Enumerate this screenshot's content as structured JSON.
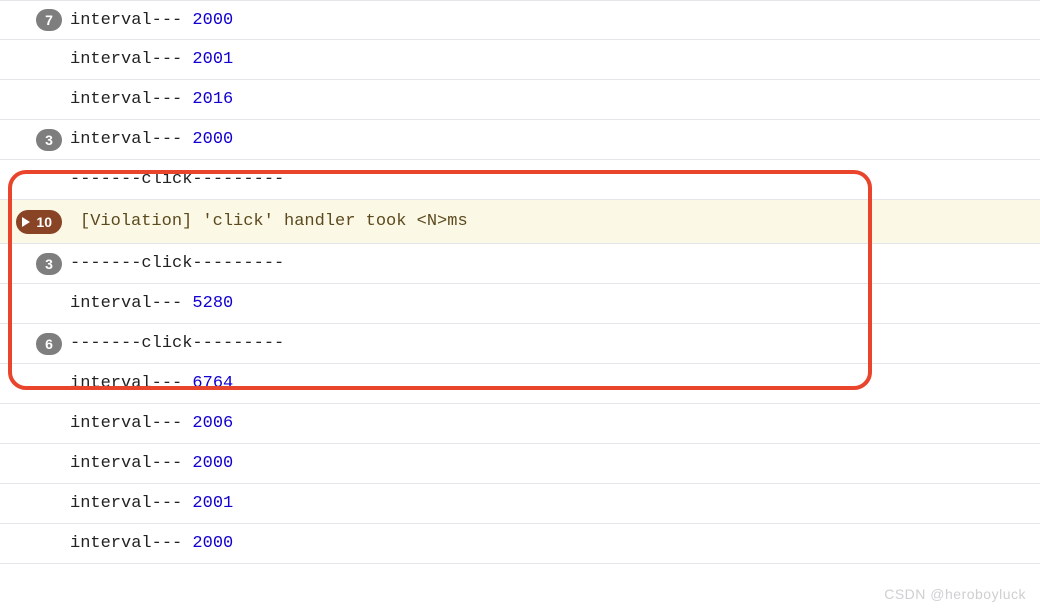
{
  "labels": {
    "interval_prefix": "interval--- ",
    "click_line": "-------click---------",
    "violation_text": "[Violation] 'click' handler took <N>ms"
  },
  "rows": [
    {
      "badge": "7",
      "type": "interval",
      "value": "2000"
    },
    {
      "badge": null,
      "type": "interval",
      "value": "2001"
    },
    {
      "badge": null,
      "type": "interval",
      "value": "2016"
    },
    {
      "badge": "3",
      "type": "interval",
      "value": "2000"
    },
    {
      "badge": null,
      "type": "click"
    },
    {
      "badge": "10",
      "type": "violation"
    },
    {
      "badge": "3",
      "type": "click"
    },
    {
      "badge": null,
      "type": "interval",
      "value": "5280"
    },
    {
      "badge": "6",
      "type": "click"
    },
    {
      "badge": null,
      "type": "interval",
      "value": "6764"
    },
    {
      "badge": null,
      "type": "interval",
      "value": "2006"
    },
    {
      "badge": null,
      "type": "interval",
      "value": "2000"
    },
    {
      "badge": null,
      "type": "interval",
      "value": "2001"
    },
    {
      "badge": null,
      "type": "interval",
      "value": "2000"
    }
  ],
  "watermark": "CSDN @heroboyluck"
}
